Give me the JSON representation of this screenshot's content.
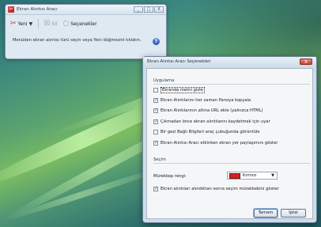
{
  "main_window": {
    "title": "Ekran Alıntısı Aracı",
    "controls": [
      "_",
      "□",
      "X"
    ],
    "toolbar": {
      "new_label": "Yeni",
      "delete_label": "Sil",
      "options_label": "Seçenekler"
    },
    "info_text": "Menüden ekran alıntısı türü seçin veya Yeni düğmesini tıklatın."
  },
  "dialog": {
    "title": "Ekran Alıntısı Aracı Seçenekleri",
    "close_label": "X",
    "applications_group": "Uygulama",
    "options": [
      {
        "label": "Ekranda metni gizle",
        "checked": false
      },
      {
        "label": "Ekran Alıntılarını her zaman Panoya kopyala",
        "checked": true
      },
      {
        "label": "Ekran Alıntılarının altına URL ekle (yalnızca HTML)",
        "checked": true
      },
      {
        "label": "Çıkmadan önce ekran alıntılarını kaydetmek için uyar",
        "checked": true
      },
      {
        "label": "Bir gezi Bağlı Bilgileri araç çubuğunda görüntüle",
        "checked": false
      },
      {
        "label": "Ekran Alıntısı Aracı etkinken ekran yer paylaşımını göster",
        "checked": true
      }
    ],
    "selection_group": "Seçim",
    "ink_color_label": "Mürekkep rengi:",
    "ink_color_value": "Kırmızı",
    "ink_color_hex": "#d52020",
    "show_ink_option": {
      "label": "Ekran alıntıları alındıktan sonra seçim mürekkebini göster",
      "checked": true
    },
    "ok_label": "Tamam",
    "cancel_label": "İptal"
  }
}
